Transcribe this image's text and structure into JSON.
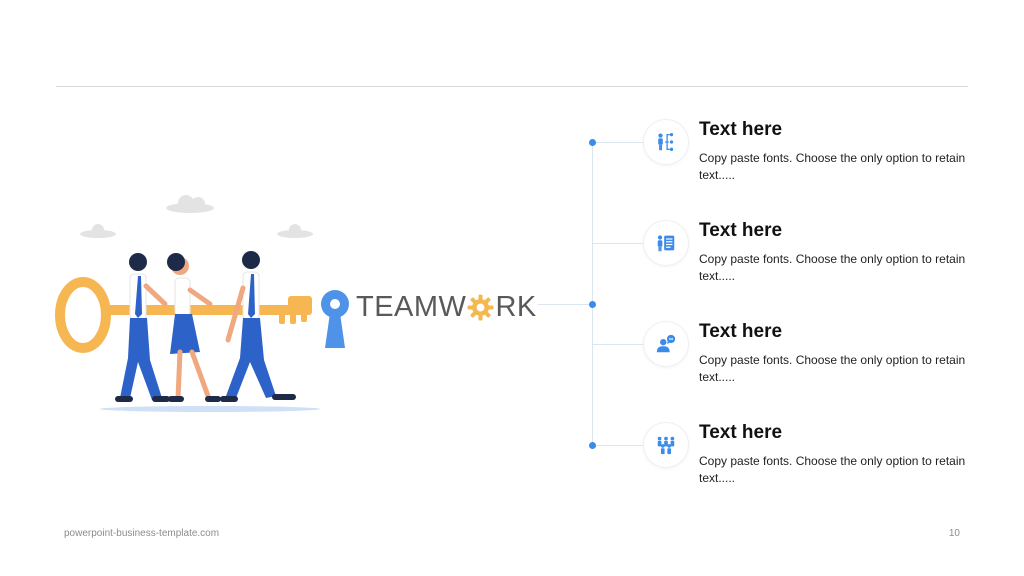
{
  "center": {
    "word_before": "TEAMW",
    "word_after": "RK",
    "accent_color": "#f4b84f",
    "keyhole_color": "#4f93e8"
  },
  "items": [
    {
      "title": "Text here",
      "desc": "Copy paste fonts. Choose the only option to retain text.....",
      "icon": "org-chart-people-icon"
    },
    {
      "title": "Text here",
      "desc": "Copy paste fonts. Choose the only option to retain text.....",
      "icon": "person-document-icon"
    },
    {
      "title": "Text here",
      "desc": "Copy paste fonts. Choose the only option to retain text.....",
      "icon": "person-speech-icon"
    },
    {
      "title": "Text here",
      "desc": "Copy paste fonts. Choose the only option to retain text.....",
      "icon": "group-people-icon"
    }
  ],
  "footer": {
    "site": "powerpoint-business-template.com",
    "page": "10"
  },
  "colors": {
    "icon_blue": "#3b8beb",
    "line": "#dce6f2",
    "rule": "#d9d9d9"
  }
}
